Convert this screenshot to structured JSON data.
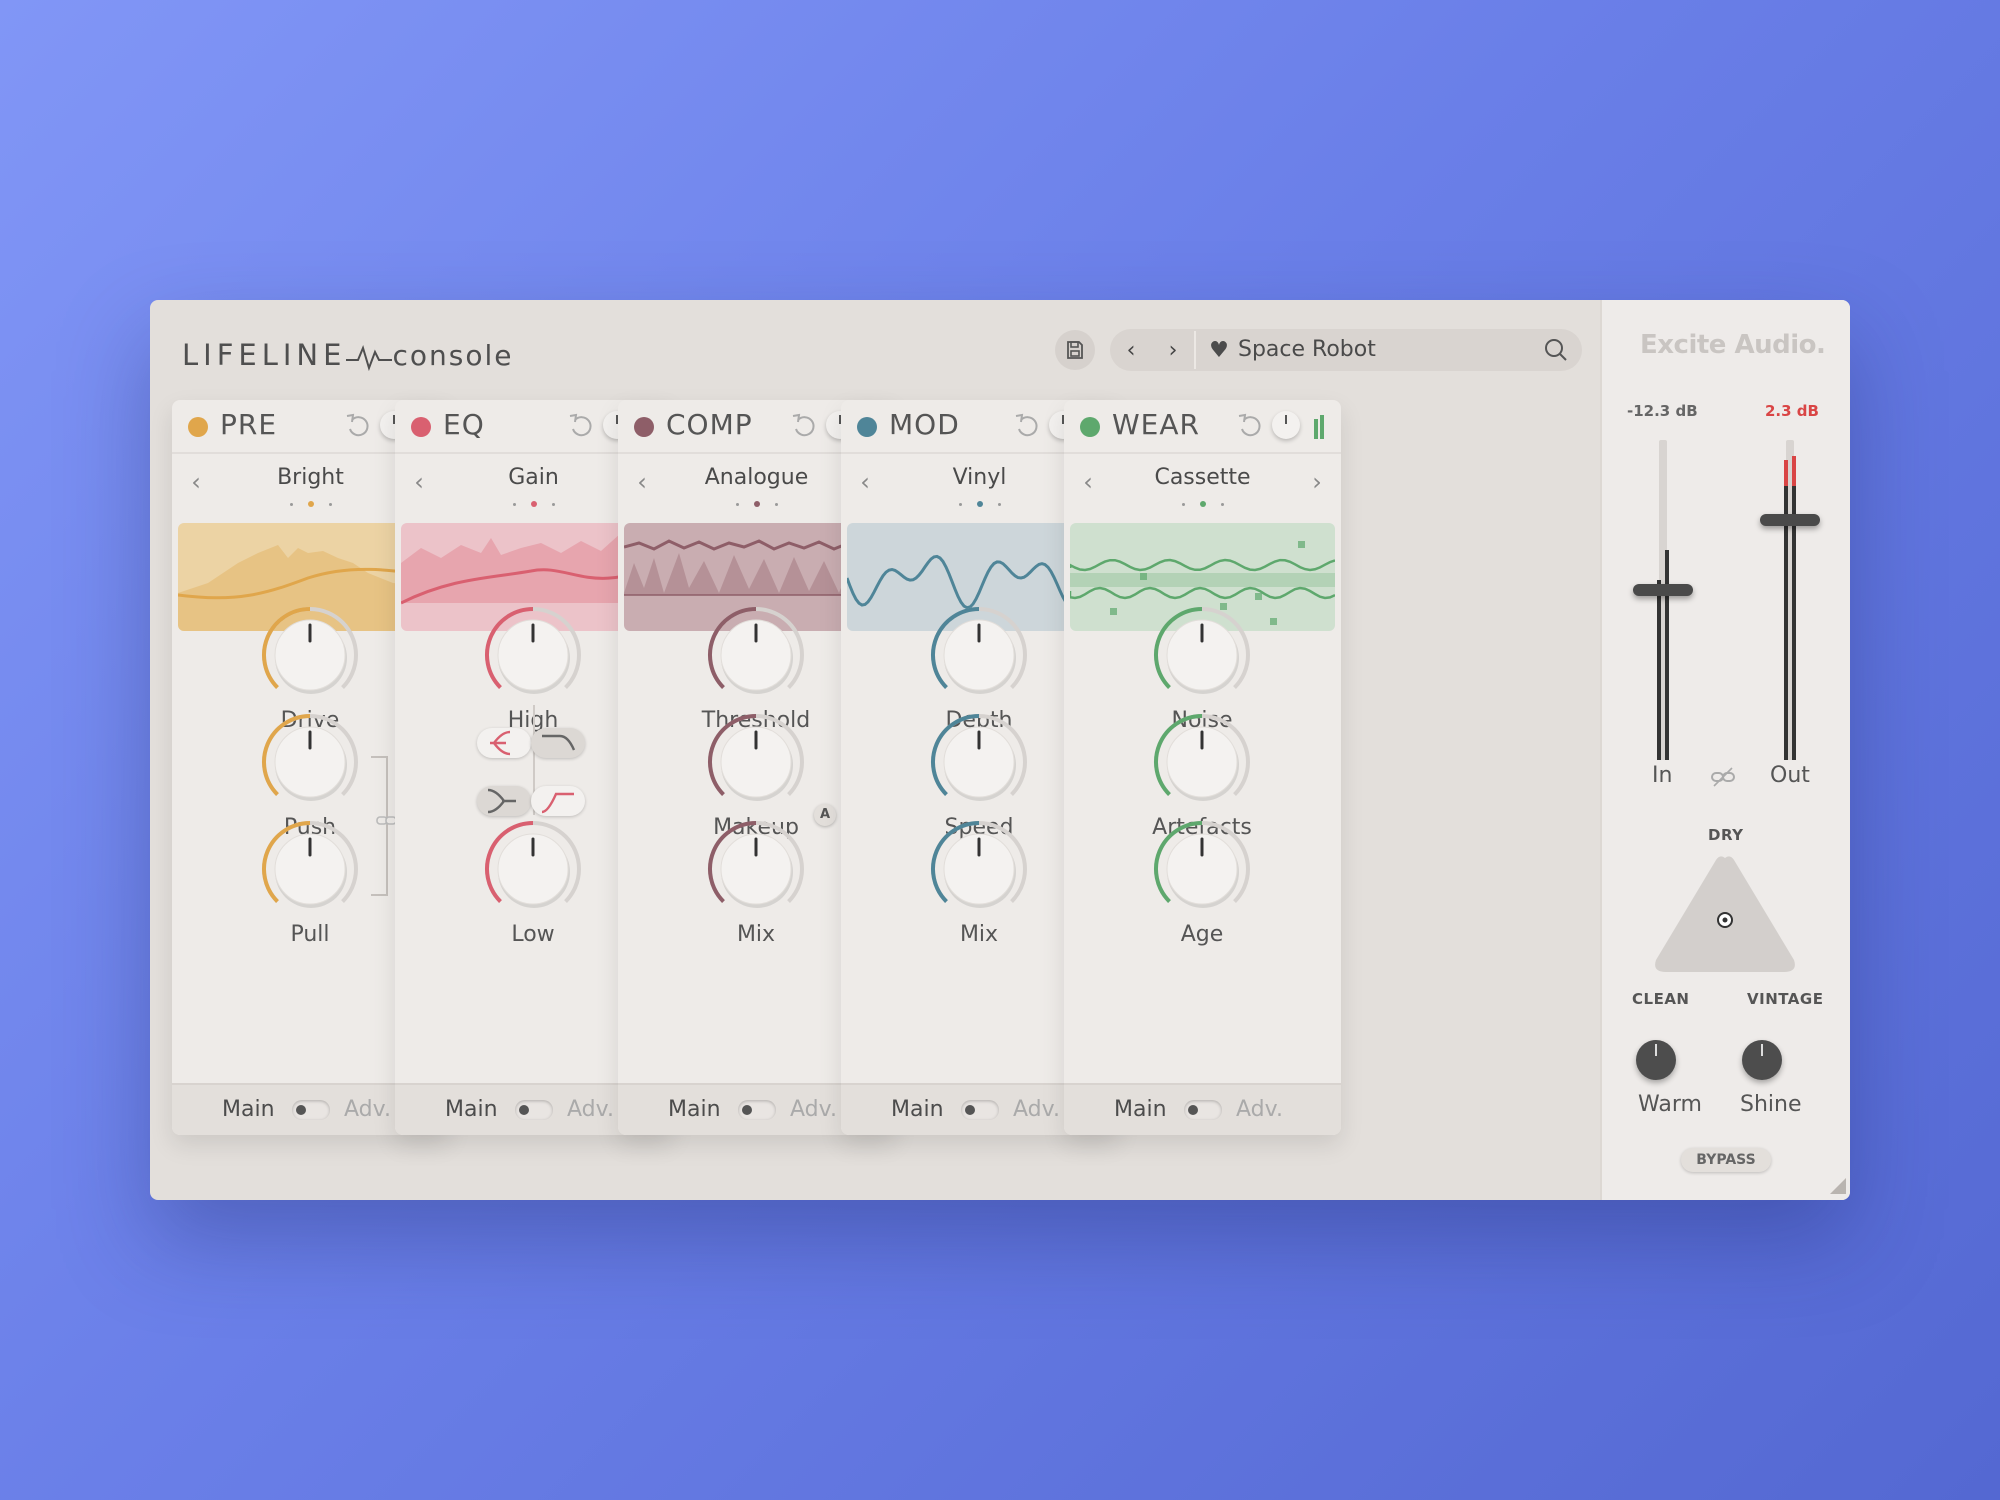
{
  "app": {
    "logo_part1": "LIFELINE",
    "logo_part2": "console",
    "brand": "Excite Audio."
  },
  "preset": {
    "name": "Space Robot",
    "prev_label": "‹",
    "next_label": "›"
  },
  "icons": {
    "save": "save-icon",
    "heart": "heart-icon",
    "search": "search-icon",
    "reset": "reset-icon",
    "link": "link-icon"
  },
  "modules": [
    {
      "title": "PRE",
      "color": "#e0a64b",
      "preset": "Bright",
      "preset_index": 2,
      "knobs": [
        "Drive",
        "Push",
        "Pull"
      ],
      "knob_values": [
        0.5,
        0.5,
        0.5
      ]
    },
    {
      "title": "EQ",
      "color": "#d96070",
      "preset": "Gain",
      "preset_index": 2,
      "knobs": [
        "High",
        "Low"
      ],
      "knob_values": [
        0.5,
        0.5
      ],
      "filter_types": [
        [
          "bell",
          "high-shelf"
        ],
        [
          "bell-alt",
          "low-shelf"
        ]
      ]
    },
    {
      "title": "COMP",
      "color": "#8e5e68",
      "preset": "Analogue",
      "preset_index": 2,
      "knobs": [
        "Threshold",
        "Makeup",
        "Mix"
      ],
      "knob_values": [
        0.5,
        0.5,
        0.5
      ],
      "auto_badge": "A"
    },
    {
      "title": "MOD",
      "color": "#4f8598",
      "preset": "Vinyl",
      "preset_index": 2,
      "knobs": [
        "Depth",
        "Speed",
        "Mix"
      ],
      "knob_values": [
        0.5,
        0.5,
        0.5
      ]
    },
    {
      "title": "WEAR",
      "color": "#5ea86d",
      "preset": "Cassette",
      "preset_index": 2,
      "knobs": [
        "Noise",
        "Artefacts",
        "Age"
      ],
      "knob_values": [
        0.5,
        0.5,
        0.5
      ]
    }
  ],
  "footer": {
    "main_label": "Main",
    "adv_label": "Adv."
  },
  "output": {
    "in_db": "-12.3 dB",
    "out_db": "2.3 dB",
    "in_label": "In",
    "out_label": "Out",
    "in_fader_level": 0.53,
    "out_fader_level": 0.75,
    "in_db_color": "#666666",
    "out_db_color": "#d94545",
    "tri_dry": "DRY",
    "tri_clean": "CLEAN",
    "tri_vintage": "VINTAGE",
    "warm_label": "Warm",
    "shine_label": "Shine",
    "bypass_label": "BYPASS"
  }
}
